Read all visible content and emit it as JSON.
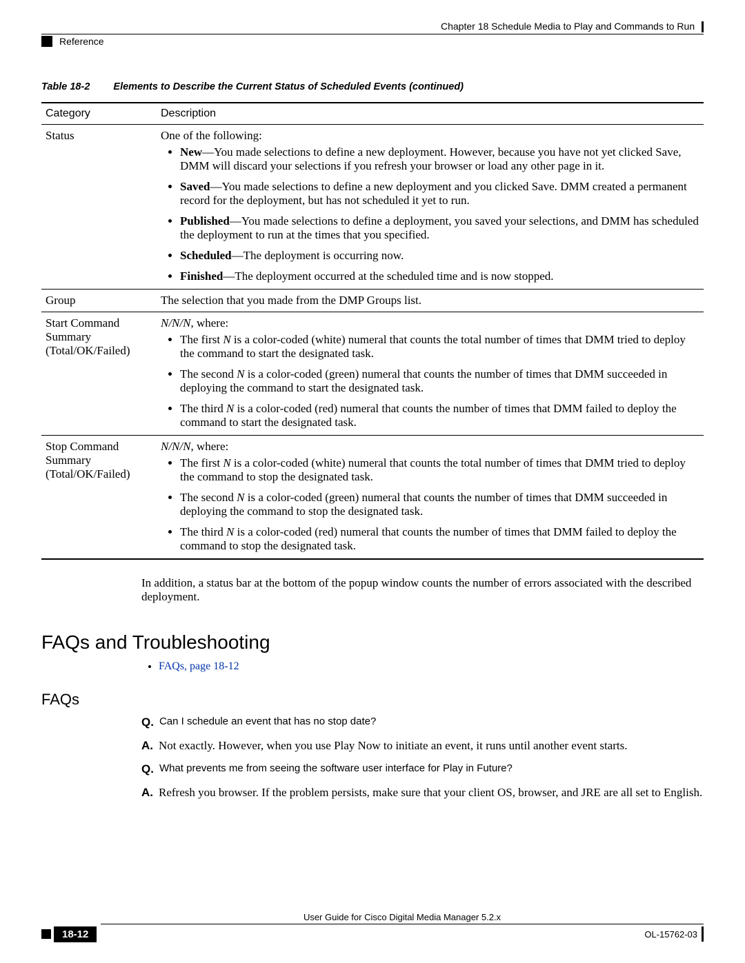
{
  "header": {
    "chapter": "Chapter 18      Schedule Media to Play and Commands to Run",
    "section": "Reference"
  },
  "table": {
    "caption_label": "Table 18-2",
    "caption_title": "Elements to Describe the Current Status of Scheduled Events (continued)",
    "head_col1": "Category",
    "head_col2": "Description",
    "row_status": {
      "cat": "Status",
      "intro": "One of the following:",
      "items": {
        "new": {
          "label": "New",
          "text": "—You made selections to define a new deployment. However, because you have not yet clicked Save, DMM will discard your selections if you refresh your browser or load any other page in it."
        },
        "saved": {
          "label": "Saved",
          "text": "—You made selections to define a new deployment and you clicked Save. DMM created a permanent record for the deployment, but has not scheduled it yet to run."
        },
        "published": {
          "label": "Published",
          "text": "—You made selections to define a deployment, you saved your selections, and DMM has scheduled the deployment to run at the times that you specified."
        },
        "scheduled": {
          "label": "Scheduled",
          "text": "—The deployment is occurring now."
        },
        "finished": {
          "label": "Finished",
          "text": "—The deployment occurred at the scheduled time and is now stopped."
        }
      }
    },
    "row_group": {
      "cat": "Group",
      "desc": "The selection that you made from the DMP Groups list."
    },
    "row_start": {
      "cat": "Start Command Summary (Total/OK/Failed)",
      "intro_pattern": "N/N/N",
      "intro_suffix": ", where:",
      "items": {
        "first_pre": "The first ",
        "first_post": " is a color-coded (white) numeral that counts the total number of times that DMM tried to deploy the command to start the designated task.",
        "second_pre": "The second ",
        "second_post": " is a color-coded (green) numeral that counts the number of times that DMM succeeded in deploying the command to start the designated task.",
        "third_pre": "The third ",
        "third_post": " is a color-coded (red) numeral that counts the number of times that DMM failed to deploy the command to start the designated task."
      }
    },
    "row_stop": {
      "cat": "Stop Command Summary (Total/OK/Failed)",
      "intro_pattern": "N/N/N",
      "intro_suffix": ", where:",
      "items": {
        "first_pre": "The first ",
        "first_post": " is a color-coded (white) numeral that counts the total number of times that DMM tried to deploy the command to stop the designated task.",
        "second_pre": "The second ",
        "second_post": " is a color-coded (green) numeral that counts the number of times that DMM succeeded in deploying the command to stop the designated task.",
        "third_pre": "The third ",
        "third_post": " is a color-coded (red) numeral that counts the number of times that DMM failed to deploy the command to stop the designated task."
      }
    },
    "N": "N"
  },
  "para_after_table": "In addition, a status bar at the bottom of the popup window counts the number of errors associated with the described deployment.",
  "sections": {
    "faqs_trouble": "FAQs and Troubleshooting",
    "faqs_link": "FAQs, page 18-12",
    "faqs_heading": "FAQs"
  },
  "qa": {
    "q1": {
      "q": "Can I schedule an event that has no stop date?",
      "a": "Not exactly. However, when you use Play Now to initiate an event, it runs until another event starts."
    },
    "q2": {
      "q": "What prevents me from seeing the software user interface for Play in Future?",
      "a": "Refresh you browser. If the problem persists, make sure that your client OS, browser, and JRE are all set to English."
    },
    "labels": {
      "Q": "Q.",
      "A": "A."
    }
  },
  "footer": {
    "title": "User Guide for Cisco Digital Media Manager 5.2.x",
    "page": "18-12",
    "docid": "OL-15762-03"
  }
}
